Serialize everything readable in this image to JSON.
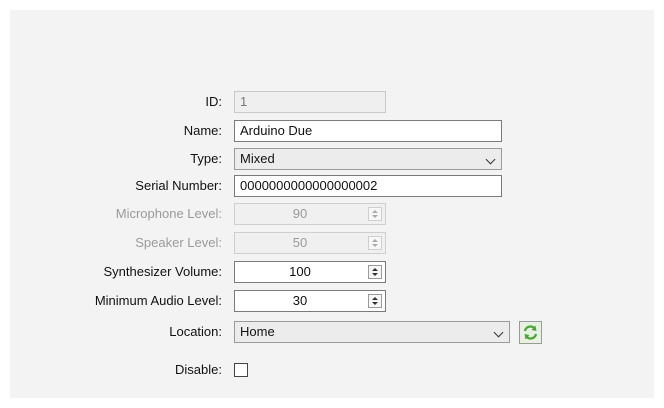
{
  "form": {
    "id": {
      "label": "ID:",
      "value": "1"
    },
    "name": {
      "label": "Name:",
      "value": "Arduino Due"
    },
    "type": {
      "label": "Type:",
      "value": "Mixed"
    },
    "serial": {
      "label": "Serial Number:",
      "value": "0000000000000000002"
    },
    "microphone": {
      "label": "Microphone Level:",
      "value": "90"
    },
    "speaker": {
      "label": "Speaker Level:",
      "value": "50"
    },
    "synth": {
      "label": "Synthesizer Volume:",
      "value": "100"
    },
    "minaudio": {
      "label": "Minimum Audio Level:",
      "value": "30"
    },
    "location": {
      "label": "Location:",
      "value": "Home"
    },
    "disable": {
      "label": "Disable:",
      "checked": false
    }
  },
  "icons": {
    "refresh": "refresh-icon",
    "dropdown": "chevron-down-icon"
  },
  "colors": {
    "refresh_arrows": "#4aa53a"
  }
}
